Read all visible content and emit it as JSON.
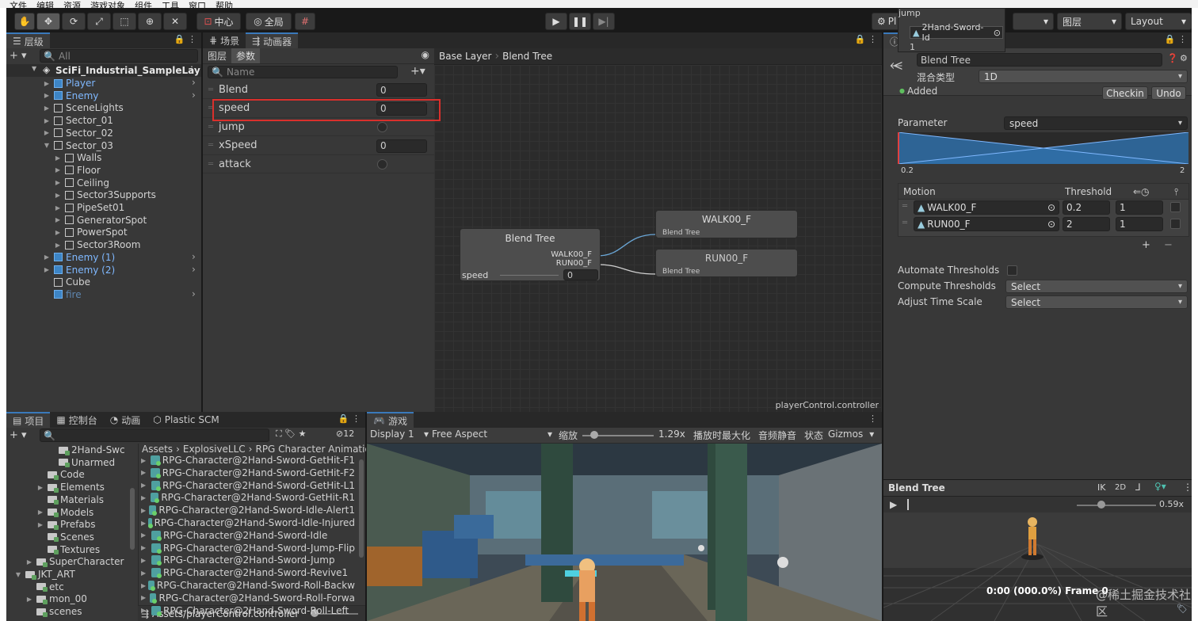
{
  "menu": [
    "文件",
    "编辑",
    "资源",
    "游戏对象",
    "组件",
    "工具",
    "窗口",
    "帮助"
  ],
  "toolbar": {
    "pivot_label": "中心",
    "global_label": "全局",
    "play_account": "Pl",
    "layers_label": "图层",
    "layout_label": "Layout",
    "popup_items": [
      "jump",
      "2Hand-Sword-Id",
      "1"
    ]
  },
  "hierarchy": {
    "tab": "层级",
    "search_placeholder": "All",
    "scene": "SciFi_Industrial_SampleLay",
    "items": [
      {
        "label": "Player",
        "depth": 1,
        "prefab": true,
        "arrow": true
      },
      {
        "label": "Enemy",
        "depth": 1,
        "prefab": true,
        "arrow": true
      },
      {
        "label": "SceneLights",
        "depth": 1,
        "prefab": false,
        "arrow": true
      },
      {
        "label": "Sector_01",
        "depth": 1,
        "prefab": false,
        "arrow": true
      },
      {
        "label": "Sector_02",
        "depth": 1,
        "prefab": false,
        "arrow": true
      },
      {
        "label": "Sector_03",
        "depth": 1,
        "prefab": false,
        "arrow": true,
        "expanded": true
      },
      {
        "label": "Walls",
        "depth": 2,
        "prefab": false,
        "arrow": true
      },
      {
        "label": "Floor",
        "depth": 2,
        "prefab": false,
        "arrow": true
      },
      {
        "label": "Ceiling",
        "depth": 2,
        "prefab": false,
        "arrow": true
      },
      {
        "label": "Sector3Supports",
        "depth": 2,
        "prefab": false,
        "arrow": true
      },
      {
        "label": "PipeSet01",
        "depth": 2,
        "prefab": false,
        "arrow": true
      },
      {
        "label": "GeneratorSpot",
        "depth": 2,
        "prefab": false,
        "arrow": true
      },
      {
        "label": "PowerSpot",
        "depth": 2,
        "prefab": false,
        "arrow": true
      },
      {
        "label": "Sector3Room",
        "depth": 2,
        "prefab": false,
        "arrow": true
      },
      {
        "label": "Enemy (1)",
        "depth": 1,
        "prefab": true,
        "arrow": true
      },
      {
        "label": "Enemy (2)",
        "depth": 1,
        "prefab": true,
        "arrow": true
      },
      {
        "label": "Cube",
        "depth": 1,
        "prefab": false,
        "arrow": false
      },
      {
        "label": "fire",
        "depth": 1,
        "prefab": true,
        "arrow": false,
        "dim": true
      }
    ]
  },
  "animator": {
    "tab_scene": "场景",
    "tab_animator": "动画器",
    "sub_layers": "图层",
    "sub_params": "参数",
    "search_placeholder": "Name",
    "breadcrumb": [
      "Base Layer",
      "Blend Tree"
    ],
    "params": [
      {
        "name": "Blend",
        "type": "float",
        "value": "0"
      },
      {
        "name": "speed",
        "type": "float",
        "value": "0"
      },
      {
        "name": "jump",
        "type": "bool"
      },
      {
        "name": "xSpeed",
        "type": "float",
        "value": "0"
      },
      {
        "name": "attack",
        "type": "bool"
      }
    ],
    "node_blend": {
      "title": "Blend Tree",
      "out1": "WALK00_F",
      "out2": "RUN00_F",
      "param": "speed",
      "value": "0"
    },
    "node_walk": {
      "title": "WALK00_F",
      "sub": "Blend Tree"
    },
    "node_run": {
      "title": "RUN00_F",
      "sub": "Blend Tree"
    },
    "controller": "playerControl.controller"
  },
  "inspector": {
    "name": "Blend Tree",
    "blend_type_label": "混合类型",
    "blend_type": "1D",
    "added": "Added",
    "checkin": "Checkin",
    "undo": "Undo",
    "parameter_label": "Parameter",
    "parameter": "speed",
    "range_min": "0.2",
    "range_max": "2",
    "motion_header": "Motion",
    "threshold_header": "Threshold",
    "motions": [
      {
        "name": "WALK00_F",
        "threshold": "0.2",
        "speed": "1"
      },
      {
        "name": "RUN00_F",
        "threshold": "2",
        "speed": "1"
      }
    ],
    "automate_label": "Automate Thresholds",
    "compute_label": "Compute Thresholds",
    "compute_value": "Select",
    "adjust_label": "Adjust Time Scale",
    "adjust_value": "Select"
  },
  "preview": {
    "title": "Blend Tree",
    "ik": "IK",
    "twod": "2D",
    "speed": "0.59x",
    "status": "0:00 (000.0%) Frame 0",
    "watermark": "@稀土掘金技术社区"
  },
  "project": {
    "tabs": [
      "项目",
      "控制台",
      "动画",
      "Plastic SCM"
    ],
    "count": "12",
    "folders": [
      {
        "label": "2Hand-Swc",
        "depth": 3
      },
      {
        "label": "Unarmed",
        "depth": 3
      },
      {
        "label": "Code",
        "depth": 2
      },
      {
        "label": "Elements",
        "depth": 2,
        "arrow": true
      },
      {
        "label": "Materials",
        "depth": 2
      },
      {
        "label": "Models",
        "depth": 2,
        "arrow": true
      },
      {
        "label": "Prefabs",
        "depth": 2,
        "arrow": true
      },
      {
        "label": "Scenes",
        "depth": 2
      },
      {
        "label": "Textures",
        "depth": 2
      },
      {
        "label": "SuperCharacter",
        "depth": 1,
        "arrow": true
      },
      {
        "label": "JKT_ART",
        "depth": 0,
        "arrow": true
      },
      {
        "label": "etc",
        "depth": 1
      },
      {
        "label": "mon_00",
        "depth": 1,
        "arrow": true
      },
      {
        "label": "scenes",
        "depth": 1
      }
    ],
    "path": [
      "Assets",
      "ExplosiveLLC",
      "RPG Character Animatio"
    ],
    "assets": [
      "RPG-Character@2Hand-Sword-GetHit-F1",
      "RPG-Character@2Hand-Sword-GetHit-F2",
      "RPG-Character@2Hand-Sword-GetHit-L1",
      "RPG-Character@2Hand-Sword-GetHit-R1",
      "RPG-Character@2Hand-Sword-Idle-Alert1",
      "RPG-Character@2Hand-Sword-Idle-Injured",
      "RPG-Character@2Hand-Sword-Idle",
      "RPG-Character@2Hand-Sword-Jump-Flip",
      "RPG-Character@2Hand-Sword-Jump",
      "RPG-Character@2Hand-Sword-Revive1",
      "RPG-Character@2Hand-Sword-Roll-Backw",
      "RPG-Character@2Hand-Sword-Roll-Forwa",
      "RPG-Character@2Hand-Sword-Roll-Left"
    ],
    "footer": "Assets/playerControl.controller"
  },
  "game": {
    "tab": "游戏",
    "display": "Display 1",
    "aspect": "Free Aspect",
    "scale_label": "缩放",
    "scale_value": "1.29x",
    "maximize": "播放时最大化",
    "mute": "音频静音",
    "stats": "状态",
    "gizmos": "Gizmos"
  },
  "colors": {
    "highlight": "#d9302c",
    "accent": "#3a79bb",
    "panel": "#383838",
    "dark": "#282828"
  }
}
